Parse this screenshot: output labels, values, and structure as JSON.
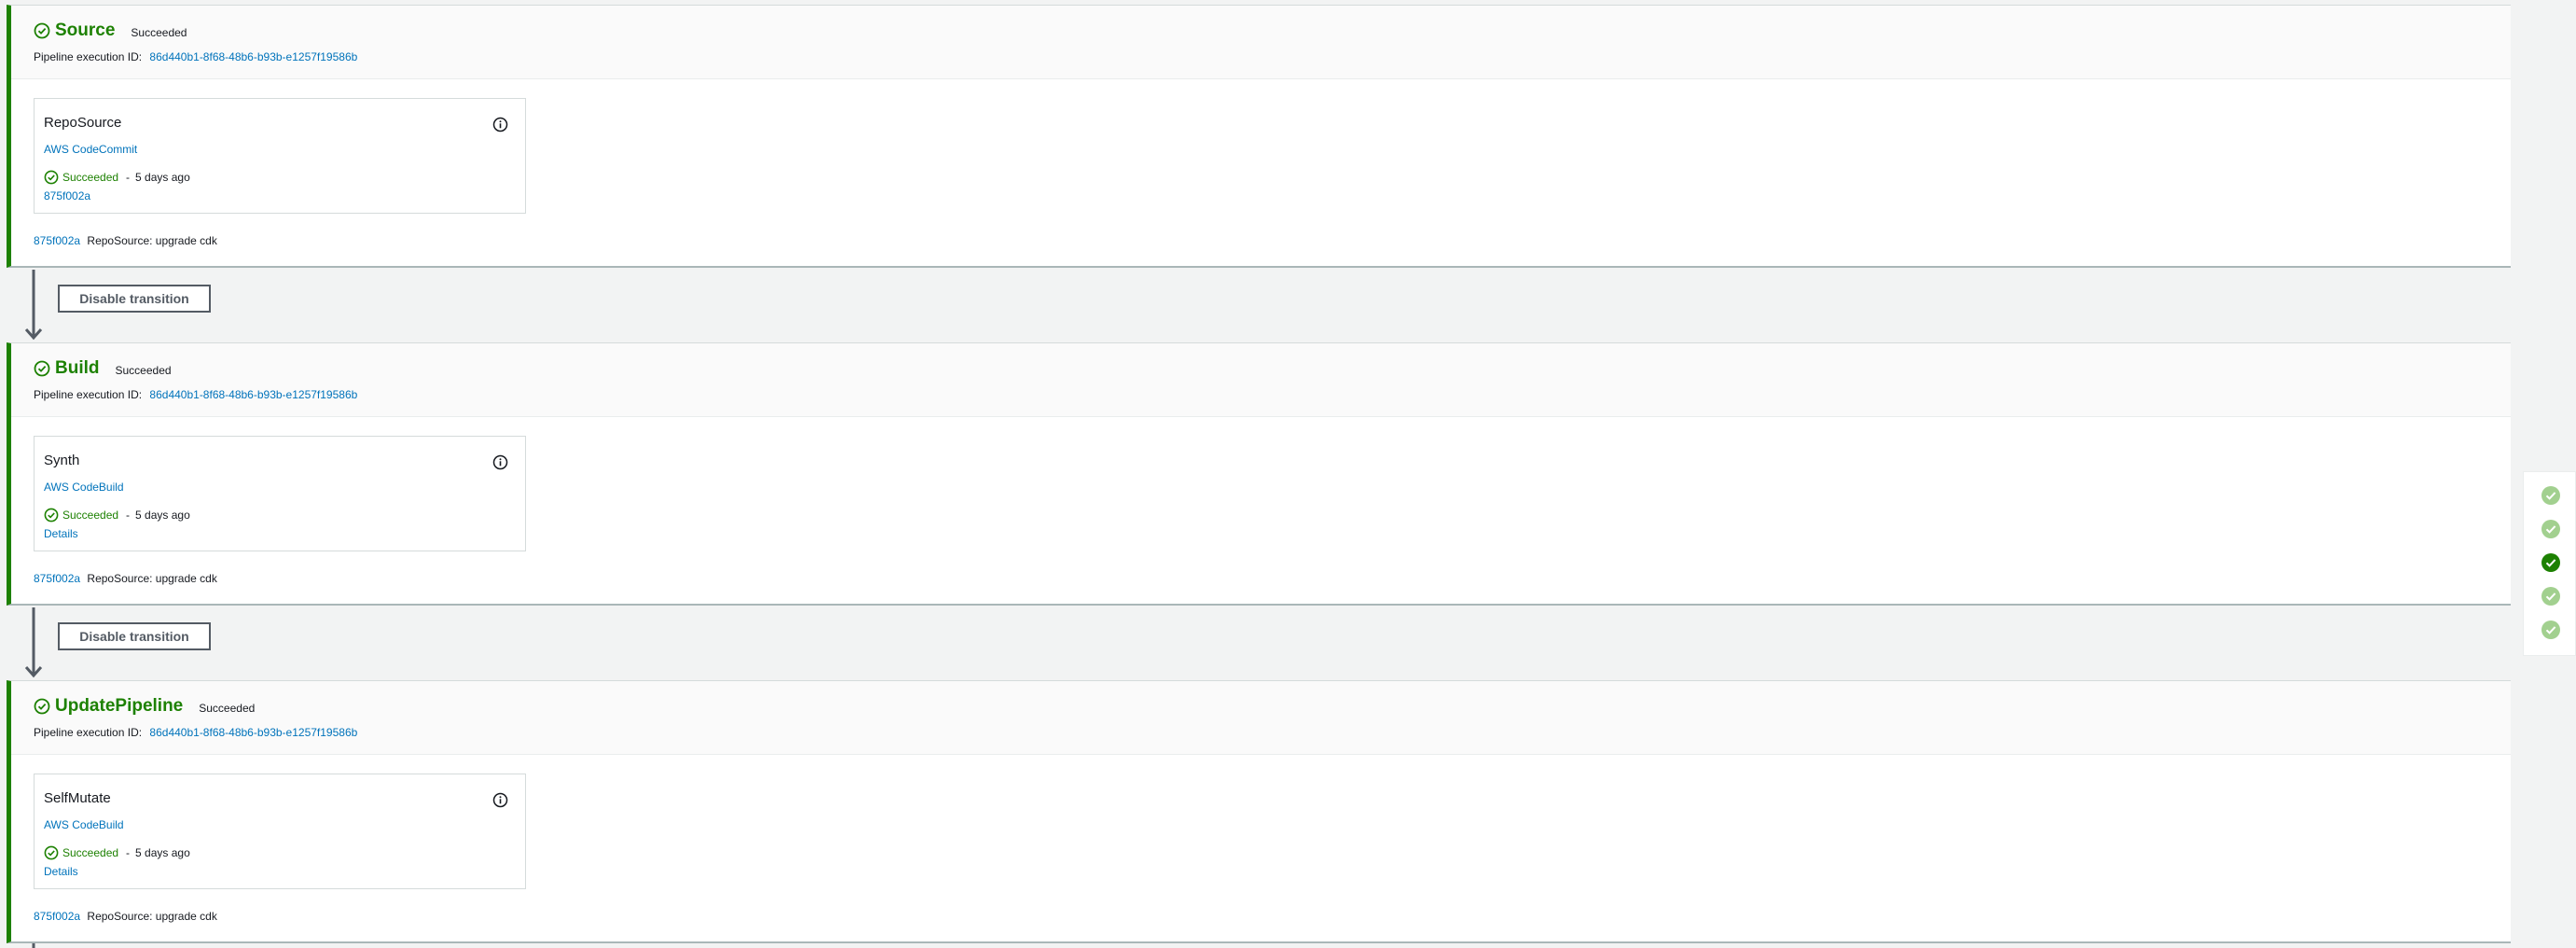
{
  "stages": [
    {
      "name": "Source",
      "status": "Succeeded",
      "exec_label": "Pipeline execution ID:",
      "exec_id": "86d440b1-8f68-48b6-b93b-e1257f19586b",
      "action": {
        "name": "RepoSource",
        "provider": "AWS CodeCommit",
        "status": "Succeeded",
        "separator": "-",
        "time": "5 days ago",
        "extra_link": "875f002a"
      },
      "commit_id": "875f002a",
      "commit_msg": "RepoSource: upgrade cdk"
    },
    {
      "name": "Build",
      "status": "Succeeded",
      "exec_label": "Pipeline execution ID:",
      "exec_id": "86d440b1-8f68-48b6-b93b-e1257f19586b",
      "action": {
        "name": "Synth",
        "provider": "AWS CodeBuild",
        "status": "Succeeded",
        "separator": "-",
        "time": "5 days ago",
        "extra_link": "Details"
      },
      "commit_id": "875f002a",
      "commit_msg": "RepoSource: upgrade cdk"
    },
    {
      "name": "UpdatePipeline",
      "status": "Succeeded",
      "exec_label": "Pipeline execution ID:",
      "exec_id": "86d440b1-8f68-48b6-b93b-e1257f19586b",
      "action": {
        "name": "SelfMutate",
        "provider": "AWS CodeBuild",
        "status": "Succeeded",
        "separator": "-",
        "time": "5 days ago",
        "extra_link": "Details"
      },
      "commit_id": "875f002a",
      "commit_msg": "RepoSource: upgrade cdk"
    }
  ],
  "transitions": [
    {
      "button_label": "Disable transition"
    },
    {
      "button_label": "Disable transition"
    }
  ],
  "navigator": {
    "items": [
      {
        "icon": "check-circle-icon",
        "active": false
      },
      {
        "icon": "check-circle-icon",
        "active": false
      },
      {
        "icon": "check-circle-icon",
        "active": true
      },
      {
        "icon": "check-circle-icon",
        "active": false
      },
      {
        "icon": "check-circle-icon",
        "active": false
      }
    ]
  },
  "colors": {
    "success": "#1d8102",
    "link": "#0073bb",
    "nav_inactive": "#a2d08f",
    "nav_active": "#1d8102"
  }
}
